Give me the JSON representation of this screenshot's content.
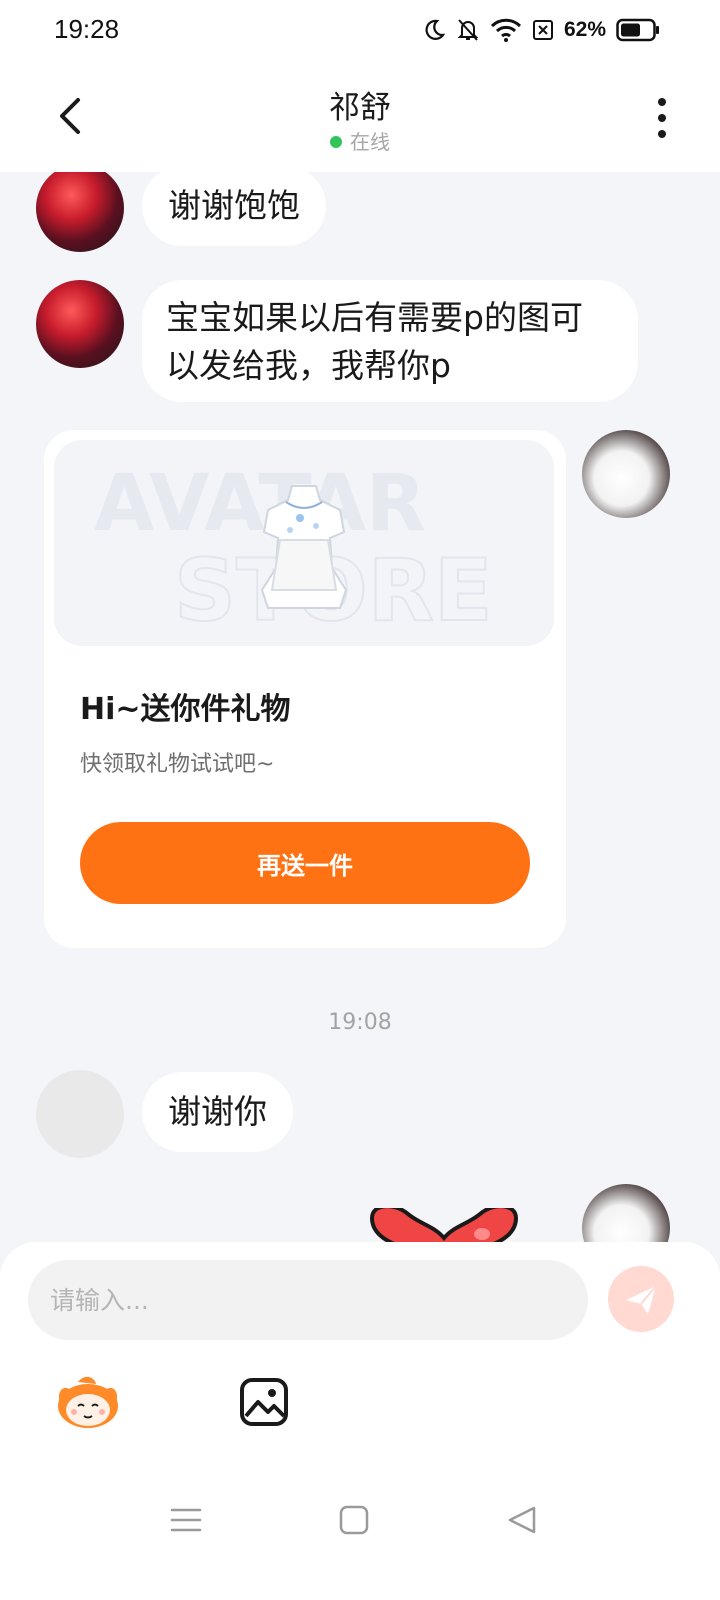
{
  "status_bar": {
    "time": "19:28",
    "battery_percent": "62%",
    "icons": [
      "moon-icon",
      "bell-off-icon",
      "wifi-icon",
      "sim-off-icon",
      "battery-icon"
    ]
  },
  "header": {
    "title": "祁舒",
    "status": "在线"
  },
  "messages": [
    {
      "side": "left",
      "text": "谢谢饱饱"
    },
    {
      "side": "left",
      "text": "宝宝如果以后有需要p的图可以发给我，我帮你p"
    }
  ],
  "gift_card": {
    "watermark_line1": "AVATAR",
    "watermark_line2": "STORE",
    "title": "Hi~送你件礼物",
    "subtitle": "快领取礼物试试吧~",
    "button_label": "再送一件"
  },
  "timestamp": "19:08",
  "message_after": {
    "side": "left",
    "text": "谢谢你"
  },
  "input": {
    "placeholder": "请输入..."
  },
  "colors": {
    "accent": "#ff7214",
    "online": "#33c35b",
    "background": "#f3f5f8"
  }
}
